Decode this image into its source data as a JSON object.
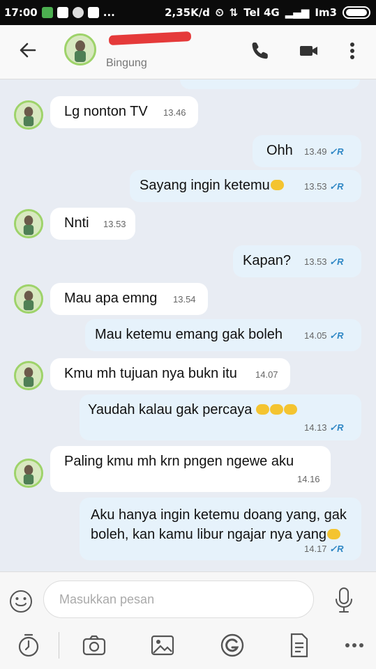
{
  "status_bar": {
    "time": "17:00",
    "speed": "2,35K/d",
    "carrier1": "Tel 4G",
    "carrier2": "Im3",
    "dots": "..."
  },
  "header": {
    "status": "Bingung",
    "name_redacted": true,
    "icons": [
      "back-arrow-icon",
      "avatar",
      "phone-icon",
      "video-icon",
      "more-vert-icon"
    ]
  },
  "messages": [
    {
      "dir": "in",
      "text": "Lg nonton TV",
      "time": "13.46"
    },
    {
      "dir": "out",
      "text": "Ohh",
      "time": "13.49",
      "status": "✓R"
    },
    {
      "dir": "out",
      "text": "Sayang ingin ketemu",
      "time": "13.53",
      "status": "✓R",
      "emoji_count": 1
    },
    {
      "dir": "in",
      "text": "Nnti",
      "time": "13.53"
    },
    {
      "dir": "out",
      "text": "Kapan?",
      "time": "13.53",
      "status": "✓R"
    },
    {
      "dir": "in",
      "text": "Mau apa emng",
      "time": "13.54"
    },
    {
      "dir": "out",
      "text": "Mau ketemu emang gak boleh",
      "time": "14.05",
      "status": "✓R"
    },
    {
      "dir": "in",
      "text": "Kmu mh tujuan nya bukn itu",
      "time": "14.07"
    },
    {
      "dir": "out",
      "text": "Yaudah kalau gak percaya",
      "time": "14.13",
      "status": "✓R",
      "emoji_count": 3
    },
    {
      "dir": "in",
      "text": "Paling kmu mh krn pngen ngewe aku",
      "time": "14.16"
    },
    {
      "dir": "out",
      "text": "Aku hanya ingin ketemu doang yang, gak\nboleh, kan kamu libur ngajar nya yang",
      "time": "14.17",
      "status": "✓R",
      "emoji_count": 1
    }
  ],
  "input": {
    "placeholder": "Masukkan pesan"
  },
  "toolbar": [
    "timer-icon",
    "camera-icon",
    "image-icon",
    "g-icon",
    "document-icon",
    "more-horiz-icon"
  ],
  "colors": {
    "incoming_bubble": "#ffffff",
    "outgoing_bubble": "#e6f2fb",
    "read_check": "#2d86c4",
    "chat_bg": "#e8ecf3"
  }
}
